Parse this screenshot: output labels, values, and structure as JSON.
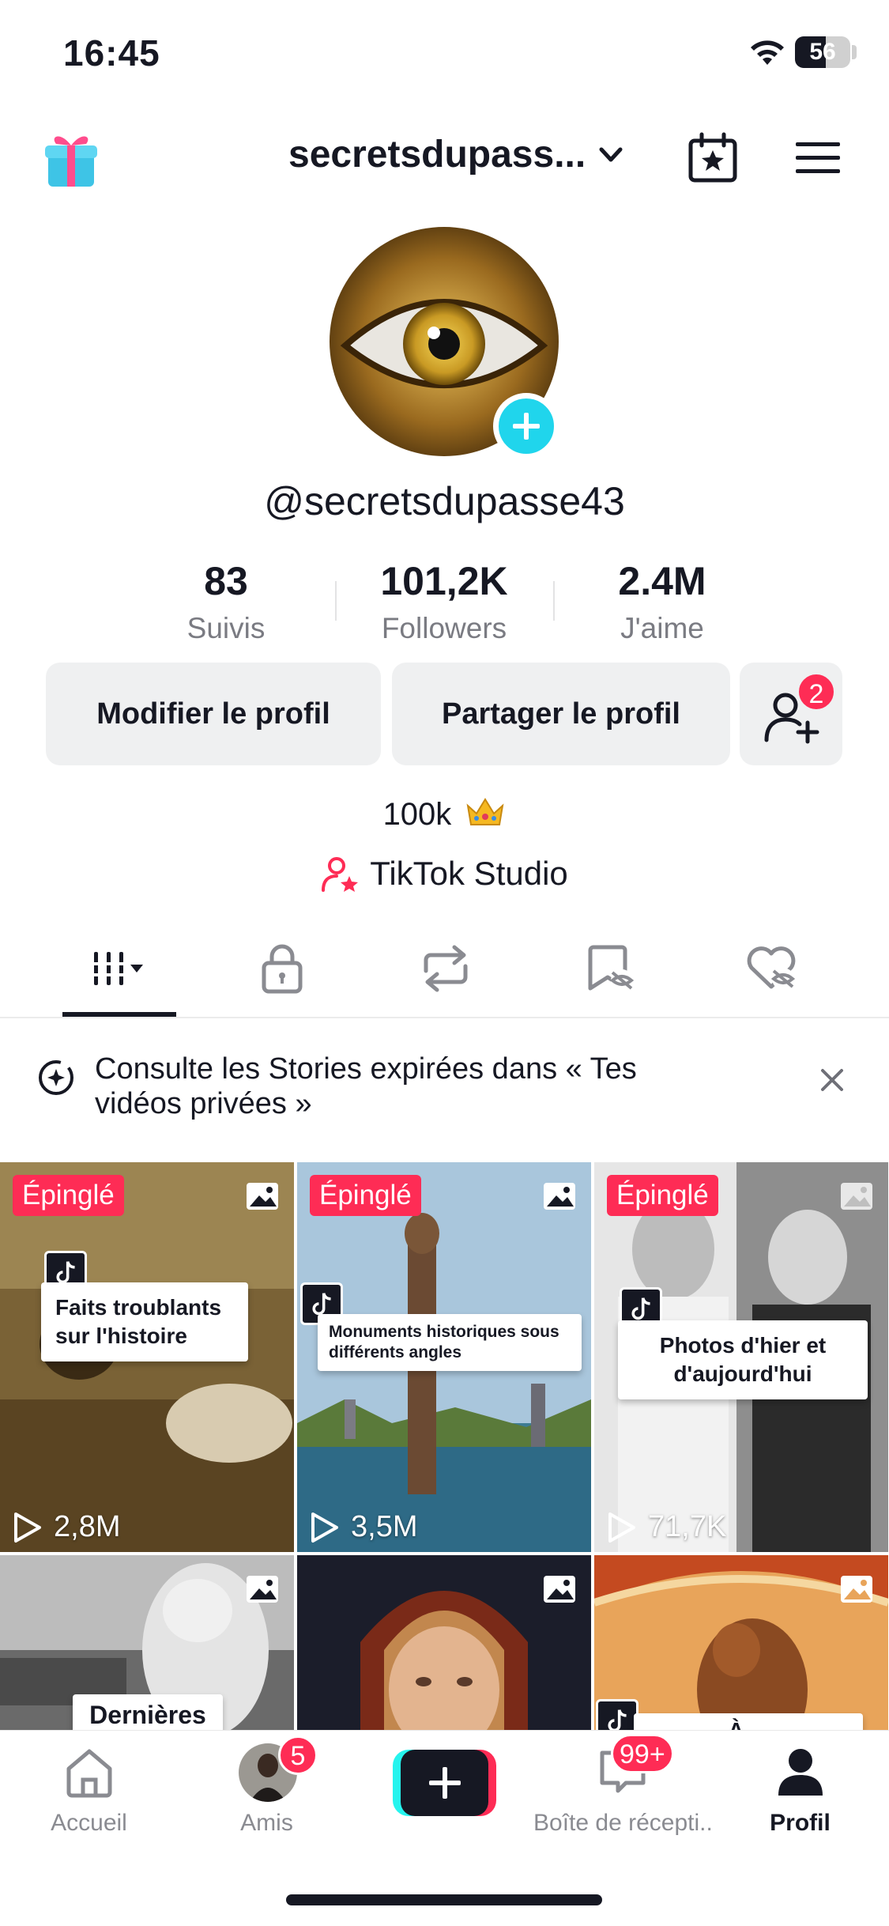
{
  "status_bar": {
    "time": "16:45",
    "battery_level": "56",
    "icons": [
      "wifi-icon",
      "battery-icon"
    ]
  },
  "top_nav": {
    "username": "secretsdupass...",
    "icons": [
      "gift-icon",
      "chevron-down-icon",
      "calendar-star-icon",
      "menu-icon"
    ]
  },
  "profile": {
    "handle": "@secretsdupasse43",
    "stats": [
      {
        "value": "83",
        "label": "Suivis"
      },
      {
        "value": "101,2K",
        "label": "Followers"
      },
      {
        "value": "2.4M",
        "label": "J'aime"
      }
    ],
    "edit_label": "Modifier le profil",
    "share_label": "Partager le profil",
    "friend_requests_badge": "2",
    "bio": "100k",
    "studio_label": "TikTok Studio"
  },
  "tabs": [
    {
      "icon": "grid-icon",
      "selected": true
    },
    {
      "icon": "lock-icon",
      "selected": false
    },
    {
      "icon": "repost-icon",
      "selected": false
    },
    {
      "icon": "bookmark-hidden-icon",
      "selected": false
    },
    {
      "icon": "liked-hidden-icon",
      "selected": false
    }
  ],
  "banner": {
    "text": "Consulte les Stories expirées dans « Tes vidéos privées »"
  },
  "grid": {
    "pinned_label": "Épinglé",
    "items": [
      {
        "caption": "Faits troublants sur l'histoire",
        "views": "2,8M",
        "pinned": true
      },
      {
        "caption": "Monuments historiques sous différents angles",
        "views": "3,5M",
        "pinned": true
      },
      {
        "caption": "Photos d'hier et d'aujourd'hui",
        "views": "71,7K",
        "pinned": true
      },
      {
        "caption": "Dernières",
        "views": "",
        "pinned": false
      },
      {
        "caption": "",
        "views": "",
        "pinned": false
      },
      {
        "caption": "À ...",
        "views": "",
        "pinned": false
      }
    ]
  },
  "bottom_nav": {
    "items": [
      {
        "label": "Accueil",
        "icon": "home-icon"
      },
      {
        "label": "Amis",
        "icon": "friends-avatar",
        "badge": "5"
      },
      {
        "label": "",
        "icon": "create-icon"
      },
      {
        "label": "Boîte de récepti...",
        "icon": "inbox-icon",
        "badge": "99+"
      },
      {
        "label": "Profil",
        "icon": "profile-icon",
        "active": true
      }
    ]
  },
  "colors": {
    "accent_red": "#fe2c55",
    "accent_cyan": "#25f4ee",
    "text": "#161823",
    "muted": "#7a7b82",
    "button_bg": "#eff0f1"
  }
}
